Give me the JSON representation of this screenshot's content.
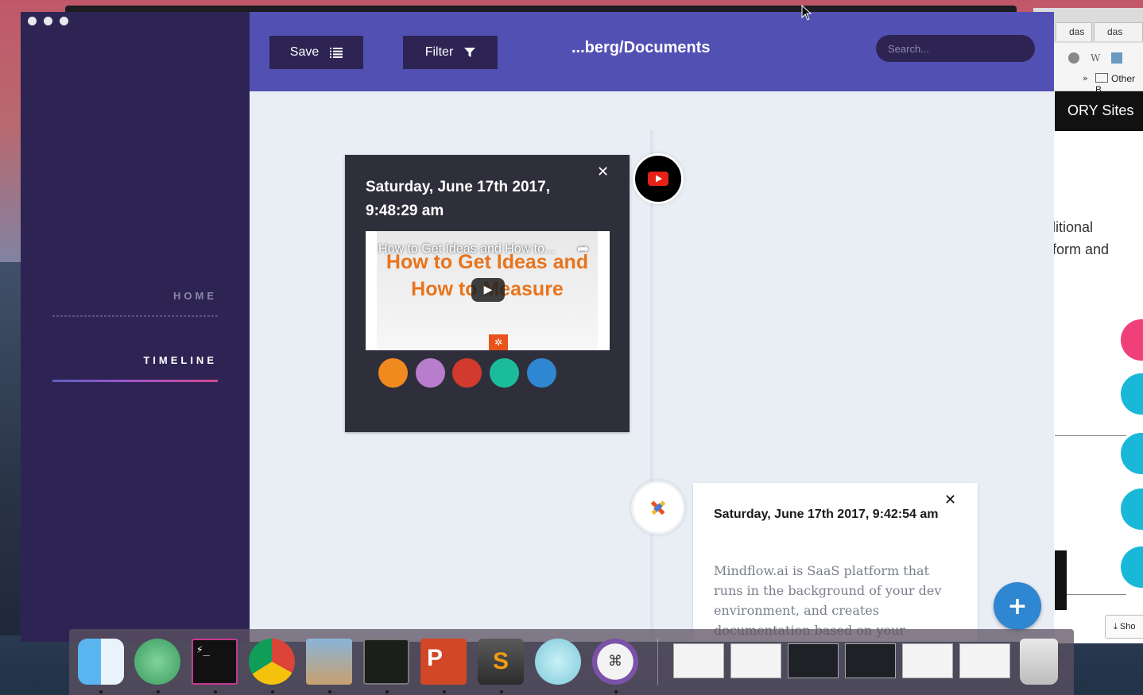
{
  "app": {
    "path_title": "...berg/Documents",
    "save_label": "Save",
    "filter_label": "Filter",
    "search_placeholder": "Search..."
  },
  "sidebar": {
    "items": [
      {
        "label": "HOME",
        "active": false
      },
      {
        "label": "TIMELINE",
        "active": true
      }
    ]
  },
  "timeline": {
    "entries": [
      {
        "date": "Saturday, June 17th 2017, 9:48:29 am",
        "type": "youtube",
        "video_title": "How to Get Ideas and How to...",
        "video_thumbnail_text": "How to Get Ideas and How to Measure",
        "color_options": [
          "#f18a1e",
          "#b87dcc",
          "#d23a2e",
          "#1abc9c",
          "#2f86d1"
        ]
      },
      {
        "date": "Saturday, June 17th 2017, 9:42:54 am",
        "type": "note",
        "body": "Mindflow.ai is SaaS platform that runs in the background of your dev environment, and creates documentation based on your"
      }
    ]
  },
  "fab": {
    "label": "+"
  },
  "background_browser": {
    "tabs": [
      "das",
      "das"
    ],
    "bookmark": "Other B",
    "nav_title": "ORY Sites",
    "text_lines": [
      "litional",
      "form and"
    ],
    "download_button": "Sho"
  },
  "dock": {
    "apps": [
      "finder-icon",
      "atom-icon",
      "terminal-icon",
      "chrome-icon",
      "preview-icon",
      "activity-monitor-icon",
      "powerpoint-icon",
      "sublime-text-icon",
      "electron-icon",
      "keyboard-shortcut-icon"
    ],
    "windows": 6
  },
  "colors": {
    "sidebar": "#2e2454",
    "topbar": "#5350b4",
    "content_bg": "#e9eef5",
    "card_dark": "#2f2f3b",
    "fab": "#2f86d1"
  }
}
